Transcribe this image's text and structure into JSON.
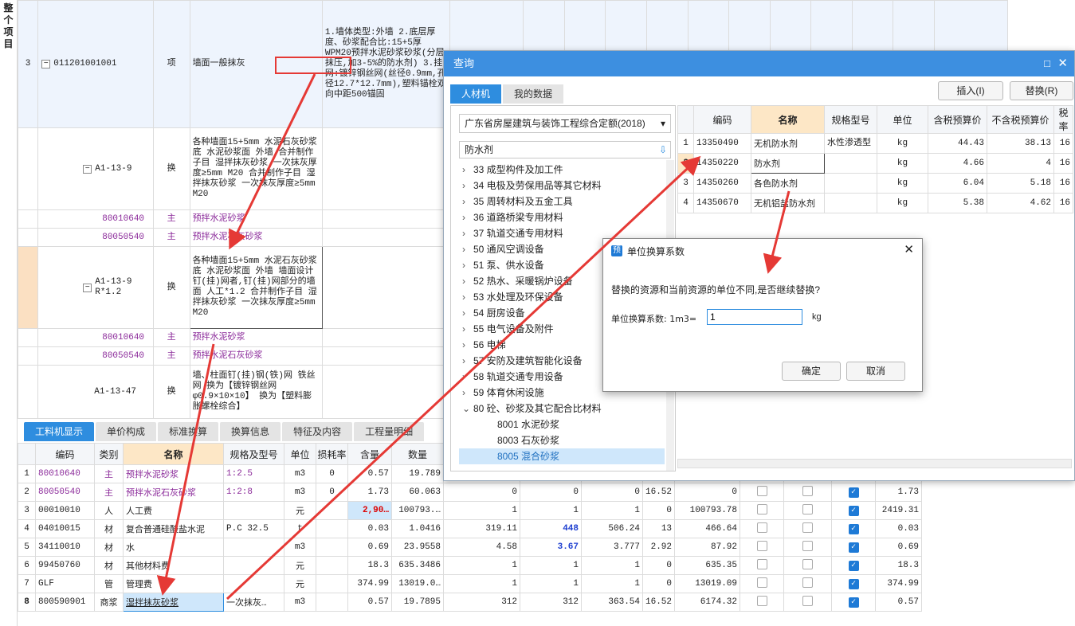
{
  "sidebar": {
    "label": "整个项目"
  },
  "top": {
    "row3": {
      "num": "3",
      "code": "011201001001",
      "type": "项",
      "name": "墙面一般抹灰",
      "desc": "1.墙体类型:外墙 2.底层厚度、砂浆配合比:15+5厚WPM20预拌水泥砂浆砂浆(分层抹压,加3-5%的防水剂) 3.挂网:镀锌钢丝网(丝径0.9mm,孔径12.7*12.7mm),塑料锚栓双向中距500锚固"
    },
    "r1": {
      "code": "A1-13-9",
      "type": "换",
      "desc": "各种墙面15+5mm 水泥石灰砂浆底 水泥砂浆面 外墙 合并制作子目 湿拌抹灰砂浆 一次抹灰厚度≥5mm M20 合并制作子目 湿拌抹灰砂浆 一次抹灰厚度≥5mm M20"
    },
    "r2": {
      "code": "80010640",
      "type": "主",
      "name": "预拌水泥砂浆"
    },
    "r3": {
      "code": "80050540",
      "type": "主",
      "name": "预拌水泥石灰砂浆"
    },
    "r4": {
      "code": "A1-13-9 R*1.2",
      "type": "换",
      "desc": "各种墙面15+5mm 水泥石灰砂浆底 水泥砂浆面 外墙 墙面设计钉(挂)网者,钉(挂)网部分的墙面 人工*1.2 合并制作子目 湿拌抹灰砂浆 一次抹灰厚度≥5mm M20"
    },
    "r5": {
      "code": "80010640",
      "type": "主",
      "name": "预拌水泥砂浆"
    },
    "r6": {
      "code": "80050540",
      "type": "主",
      "name": "预拌水泥石灰砂浆"
    },
    "r7": {
      "code": "A1-13-47",
      "type": "换",
      "desc": "墙、柱面钉(挂)钢(铁)网 铁丝网 换为【镀锌钢丝网φ0.9×10×10】 换为【塑料膨胀螺栓综合】"
    }
  },
  "tabs": [
    "工料机显示",
    "单价构成",
    "标准换算",
    "换算信息",
    "特征及内容",
    "工程量明细"
  ],
  "bottom": {
    "headers": [
      "编码",
      "类别",
      "名称",
      "规格及型号",
      "单位",
      "损耗率",
      "含量",
      "数量"
    ],
    "rows": [
      {
        "n": "1",
        "code": "80010640",
        "cat": "主",
        "name": "预拌水泥砂浆",
        "spec": "1:2.5",
        "unit": "m3",
        "loss": "0",
        "qty": "0.57",
        "num": "19.789",
        "c1": "",
        "c2": "",
        "c3": "",
        "c4": "",
        "c5": "",
        "last": ""
      },
      {
        "n": "2",
        "code": "80050540",
        "cat": "主",
        "name": "预拌水泥石灰砂浆",
        "spec": "1:2:8",
        "unit": "m3",
        "loss": "0",
        "qty": "1.73",
        "num": "60.063",
        "c1": "0",
        "c2": "0",
        "c3": "0",
        "c4": "16.52",
        "c5": "0",
        "last": "1.73"
      },
      {
        "n": "3",
        "code": "00010010",
        "cat": "人",
        "name": "人工费",
        "spec": "",
        "unit": "元",
        "loss": "",
        "qty": "2,90…",
        "num": "100793.…",
        "c1": "1",
        "c2": "1",
        "c3": "1",
        "c4": "0",
        "c5": "100793.78",
        "last": "2419.31"
      },
      {
        "n": "4",
        "code": "04010015",
        "cat": "材",
        "name": "复合普通硅酸盐水泥",
        "spec": "P.C 32.5",
        "unit": "t",
        "loss": "",
        "qty": "0.03",
        "num": "1.0416",
        "c1": "319.11",
        "c2": "448",
        "c3": "506.24",
        "c4": "13",
        "c5": "466.64",
        "last": "0.03"
      },
      {
        "n": "5",
        "code": "34110010",
        "cat": "材",
        "name": "水",
        "spec": "",
        "unit": "m3",
        "loss": "",
        "qty": "0.69",
        "num": "23.9558",
        "c1": "4.58",
        "c2": "3.67",
        "c3": "3.777",
        "c4": "2.92",
        "c5": "87.92",
        "last": "0.69"
      },
      {
        "n": "6",
        "code": "99450760",
        "cat": "材",
        "name": "其他材料费",
        "spec": "",
        "unit": "元",
        "loss": "",
        "qty": "18.3",
        "num": "635.3486",
        "c1": "1",
        "c2": "1",
        "c3": "1",
        "c4": "0",
        "c5": "635.35",
        "last": "18.3"
      },
      {
        "n": "7",
        "code": "GLF",
        "cat": "管",
        "name": "管理费",
        "spec": "",
        "unit": "元",
        "loss": "",
        "qty": "374.99",
        "num": "13019.0…",
        "c1": "1",
        "c2": "1",
        "c3": "1",
        "c4": "0",
        "c5": "13019.09",
        "last": "374.99"
      },
      {
        "n": "8",
        "code": "800590901",
        "cat": "商浆",
        "name": "湿拌抹灰砂浆",
        "spec": "一次抹灰…",
        "unit": "m3",
        "loss": "",
        "qty": "0.57",
        "num": "19.7895",
        "c1": "312",
        "c2": "312",
        "c3": "363.54",
        "c4": "16.52",
        "c5": "6174.32",
        "last": "0.57"
      }
    ]
  },
  "query": {
    "title": "查询",
    "tabs": [
      "人材机",
      "我的数据"
    ],
    "insert": "插入(I)",
    "replace": "替换(R)",
    "quota": "广东省房屋建筑与装饰工程综合定额(2018)",
    "search": "防水剂",
    "tree": [
      "33 成型构件及加工件",
      "34 电极及劳保用品等其它材料",
      "35 周转材料及五金工具",
      "36 道路桥梁专用材料",
      "37 轨道交通专用材料",
      "50 通风空调设备",
      "51 泵、供水设备",
      "52 热水、采暖锅炉设备",
      "53 水处理及环保设备",
      "54 厨房设备",
      "55 电气设备及附件",
      "56 电梯",
      "57 安防及建筑智能化设备",
      "58 轨道交通专用设备",
      "59 体育休闲设施",
      "80 砼、砂浆及其它配合比材料",
      "8001 水泥砂浆",
      "8003 石灰砂浆",
      "8005 混合砂浆"
    ],
    "headers": [
      "编码",
      "名称",
      "规格型号",
      "单位",
      "含税预算价",
      "不含税预算价",
      "税率"
    ],
    "rows": [
      {
        "n": "1",
        "code": "13350490",
        "name": "无机防水剂",
        "spec": "水性渗透型",
        "unit": "kg",
        "p1": "44.43",
        "p2": "38.13",
        "tax": "16"
      },
      {
        "n": "2",
        "code": "14350220",
        "name": "防水剂",
        "spec": "",
        "unit": "kg",
        "p1": "4.66",
        "p2": "4",
        "tax": "16"
      },
      {
        "n": "3",
        "code": "14350260",
        "name": "各色防水剂",
        "spec": "",
        "unit": "kg",
        "p1": "6.04",
        "p2": "5.18",
        "tax": "16"
      },
      {
        "n": "4",
        "code": "14350670",
        "name": "无机铝盐防水剂",
        "spec": "",
        "unit": "kg",
        "p1": "5.38",
        "p2": "4.62",
        "tax": "16"
      }
    ]
  },
  "unit_dialog": {
    "title": "单位换算系数",
    "msg": "替换的资源和当前资源的单位不同,是否继续替换?",
    "label": "单位换算系数: 1m3=",
    "value": "1",
    "unit": "kg",
    "ok": "确定",
    "cancel": "取消"
  }
}
